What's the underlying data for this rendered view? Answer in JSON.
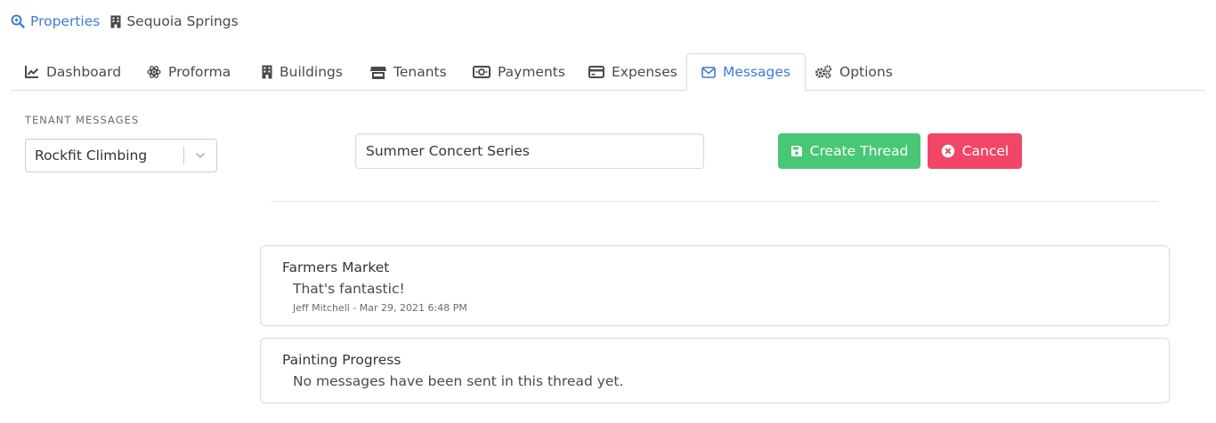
{
  "breadcrumb": {
    "root_label": "Properties",
    "current_label": "Sequoia Springs",
    "root_icon": "search-icon",
    "current_icon": "building-icon"
  },
  "tabs": [
    {
      "label": "Dashboard",
      "icon": "chart-line-icon",
      "active": false
    },
    {
      "label": "Proforma",
      "icon": "atom-icon",
      "active": false
    },
    {
      "label": "Buildings",
      "icon": "building-icon",
      "active": false
    },
    {
      "label": "Tenants",
      "icon": "store-icon",
      "active": false
    },
    {
      "label": "Payments",
      "icon": "money-bill-icon",
      "active": false
    },
    {
      "label": "Expenses",
      "icon": "credit-card-icon",
      "active": false
    },
    {
      "label": "Messages",
      "icon": "envelope-icon",
      "active": true
    },
    {
      "label": "Options",
      "icon": "gears-icon",
      "active": false
    }
  ],
  "tenant_messages": {
    "section_label": "TENANT MESSAGES",
    "selected_tenant": "Rockfit Climbing"
  },
  "new_thread": {
    "input_value": "Summer Concert Series",
    "create_label": "Create Thread",
    "cancel_label": "Cancel"
  },
  "threads": [
    {
      "title": "Farmers Market",
      "last_message": "That's fantastic!",
      "meta": "Jeff Mitchell - Mar 29, 2021 6:48 PM"
    },
    {
      "title": "Painting Progress",
      "last_message": "No messages have been sent in this thread yet."
    }
  ],
  "colors": {
    "link": "#3e7bd6",
    "success": "#48c774",
    "danger": "#f14668",
    "border": "#dbdbdb"
  }
}
